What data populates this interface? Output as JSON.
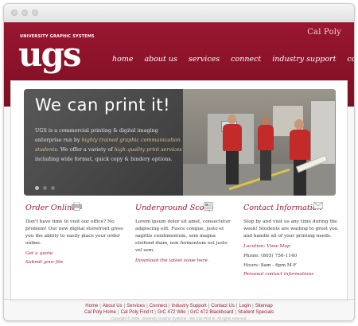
{
  "brand": {
    "tagline": "UNIVERSITY GRAPHIC SYSTEMS",
    "logo": "ugs",
    "partner": "Cal Poly"
  },
  "nav": [
    "home",
    "about us",
    "services",
    "connect",
    "industry support",
    "contact us"
  ],
  "hero": {
    "title": "We can print it!",
    "text_1": "UGS is a commercial printing & digital imaging enterprise run by ",
    "text_hl_1": "highly trained graphic communication students.",
    "text_2": " We offer a variety of ",
    "text_hl_2": "high quality print services",
    "text_3": " including wide format, quick copy & bindery options."
  },
  "columns": {
    "order_online": {
      "title": "Order Online",
      "text": "Don't have time to visit our office? No problem! Our new digital storefront gives you the ability to easily place your order online.",
      "link_1": "Get a quote",
      "link_2": "Submit your file"
    },
    "underground_scoop": {
      "title": "Underground Scoop",
      "text": "Lorem ipsum dolor sit amet, consectetur adipiscing elit. Fusce congue, justo et sagittis condimentum, sem magna eleifend diam, non fermentum est justo vel sem.",
      "link": "Download the latest issue here."
    },
    "contact": {
      "title": "Contact Information",
      "text": "Stop by and visit us any time during the week! Students are waiting to greet you and handle all of your printing needs.",
      "location_label": "Location:",
      "location_link": "View Map",
      "phone": "Phone: (805) 756-1140",
      "hours": "Hours: 8am - 6pm M-F",
      "link": "Personal contact informations"
    }
  },
  "footer": {
    "row1": [
      "Home",
      "About Us",
      "Services",
      "Connect",
      "Industry Support",
      "Contact Us",
      "Login",
      "Sitemap"
    ],
    "row2": [
      "Cal Poly Home",
      "Cal Poly Find It",
      "GrC 472 Wiki",
      "GrC 472 Blackboard",
      "Student Specials"
    ],
    "copyright": "Copyright © 2009, University Graphic Systems · We Can Print It!. All rights reserved."
  },
  "colors": {
    "maroon": "#8b1228",
    "accent_text": "#9b1b30",
    "hero_highlight": "#d8c38a"
  },
  "icons": [
    "printer-icon",
    "newspaper-icon",
    "mail-icon"
  ]
}
